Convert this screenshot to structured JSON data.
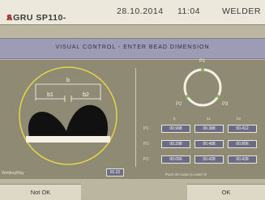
{
  "header": {
    "model_prefix": "AGRU SP110-",
    "model_suffix": "S",
    "date": "28.10.2014",
    "time": "11:04",
    "mode": "WELDER"
  },
  "title": "VISUAL CONTROL - ENTER BEAD DIMENSION",
  "bead_diagram": {
    "label_b": "b",
    "label_b1": "b1",
    "label_b2": "b2",
    "welding_way_label": "WeldingWay",
    "welding_way_value": "01.22"
  },
  "pipe_diagram": {
    "p1": "P1",
    "p2": "P2",
    "p3": "P3"
  },
  "table": {
    "headers": [
      "b",
      "b1",
      "b2"
    ],
    "rows": [
      {
        "label": "P1 :",
        "b": "00.998",
        "b1": "00.388",
        "b2": "00.412"
      },
      {
        "label": "P2 :",
        "b": "00.298",
        "b1": "00.488",
        "b2": "00.806"
      },
      {
        "label": "P3 :",
        "b": "00.056",
        "b1": "00.428",
        "b2": "00.428"
      }
    ]
  },
  "hint": "Push the value to enter it!",
  "buttons": {
    "not_ok": "Not OK",
    "ok": "OK"
  },
  "colors": {
    "title_bar": "#9e9bb5",
    "panel": "#8e8a73",
    "highlight_circle": "#e8d44a",
    "accent_red": "#d02020"
  }
}
